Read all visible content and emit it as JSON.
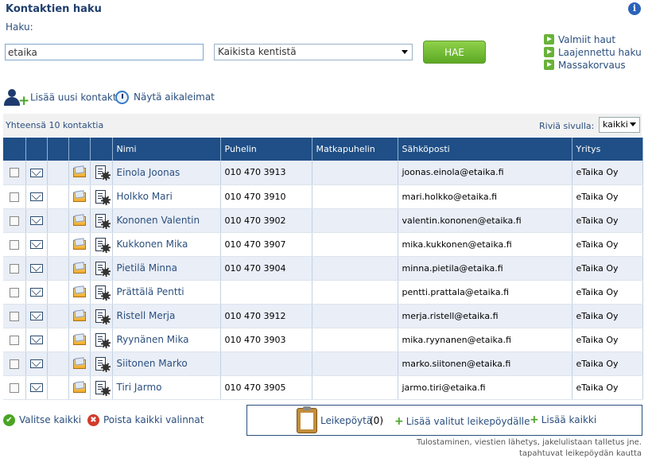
{
  "header": {
    "title": "Kontaktien haku",
    "search_label": "Haku:"
  },
  "search": {
    "value": "etaika",
    "field_select": "Kaikista kentistä",
    "button_label": "HAE"
  },
  "side_links": [
    {
      "label": "Valmiit haut"
    },
    {
      "label": "Laajennettu haku"
    },
    {
      "label": "Massakorvaus"
    }
  ],
  "actions": {
    "add_contact": "Lisää uusi kontakti",
    "show_timestamps": "Näytä aikaleimat"
  },
  "summary": {
    "total": "Yhteensä 10 kontaktia",
    "rows_label": "Riviä sivulla:",
    "rows_value": "kaikki"
  },
  "table": {
    "columns": [
      "Nimi",
      "Puhelin",
      "Matkapuhelin",
      "Sähköposti",
      "Yritys"
    ],
    "rows": [
      {
        "name": "Einola Joonas",
        "phone": "010 470 3913",
        "mobile": "",
        "email": "joonas.einola@etaika.fi",
        "company": "eTaika Oy"
      },
      {
        "name": "Holkko Mari",
        "phone": "010 470 3910",
        "mobile": "",
        "email": "mari.holkko@etaika.fi",
        "company": "eTaika Oy"
      },
      {
        "name": "Kononen Valentin",
        "phone": "010 470 3902",
        "mobile": "",
        "email": "valentin.kononen@etaika.fi",
        "company": "eTaika Oy"
      },
      {
        "name": "Kukkonen Mika",
        "phone": "010 470 3907",
        "mobile": "",
        "email": "mika.kukkonen@etaika.fi",
        "company": "eTaika Oy"
      },
      {
        "name": "Pietilä Minna",
        "phone": "010 470 3904",
        "mobile": "",
        "email": "minna.pietila@etaika.fi",
        "company": "eTaika Oy"
      },
      {
        "name": "Prättälä Pentti",
        "phone": "",
        "mobile": "",
        "email": "pentti.prattala@etaika.fi",
        "company": "eTaika Oy"
      },
      {
        "name": "Ristell Merja",
        "phone": "010 470 3912",
        "mobile": "",
        "email": "merja.ristell@etaika.fi",
        "company": "eTaika Oy"
      },
      {
        "name": "Ryynänen Mika",
        "phone": "010 470 3903",
        "mobile": "",
        "email": "mika.ryynanen@etaika.fi",
        "company": "eTaika Oy"
      },
      {
        "name": "Siitonen Marko",
        "phone": "",
        "mobile": "",
        "email": "marko.siitonen@etaika.fi",
        "company": "eTaika Oy"
      },
      {
        "name": "Tiri Jarmo",
        "phone": "010 470 3905",
        "mobile": "",
        "email": "jarmo.tiri@etaika.fi",
        "company": "eTaika Oy"
      }
    ]
  },
  "bottom": {
    "select_all": "Valitse kaikki",
    "clear_all": "Poista kaikki valinnat",
    "clipboard_label": "Leikepöytä",
    "clipboard_count": "(0)",
    "add_selected": "Lisää valitut leikepöydälle",
    "add_all": "Lisää kaikki"
  },
  "footer": {
    "line1": "Tulostaminen, viestien lähetys, jakelulistaan talletus jne.",
    "line2": "tapahtuvat leikepöydän kautta"
  },
  "icons": {
    "info": "info-icon",
    "add_contact": "add-user-icon",
    "timestamps": "clock-icon",
    "row_email": "mail-icon",
    "row_post": "letter-icon",
    "row_edit": "document-gear-icon",
    "select_all": "check-circle-icon",
    "clear_all": "x-circle-icon",
    "clipboard": "clipboard-icon"
  },
  "colors": {
    "header_bg": "#1f4f86",
    "button_green": "#6bba2f",
    "row_alt": "#e9eef7",
    "link": "#2b4f7e"
  }
}
